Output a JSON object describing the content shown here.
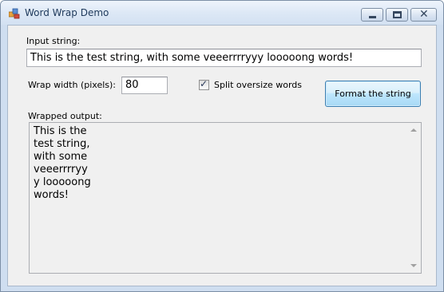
{
  "window": {
    "title": "Word Wrap Demo",
    "controls": {
      "minimize": "minimize-icon",
      "maximize": "maximize-icon",
      "close": "close-icon"
    }
  },
  "form": {
    "input_label": "Input string:",
    "input_value": "This is the test string, with some veeerrrryyy looooong words!",
    "wrap_width_label": "Wrap width (pixels):",
    "wrap_width_value": "80",
    "split_checkbox_label": "Split oversize words",
    "split_checkbox_checked": true,
    "format_button_label": "Format the string",
    "output_label": "Wrapped output:",
    "output_lines": [
      "This is the",
      "test string,",
      "with some",
      "veeerrrryy",
      "y looooong",
      "words!"
    ]
  },
  "colors": {
    "titlebar": "#dbe7f5",
    "client_background": "#f0f0f0",
    "button_accent": "#3c7fb1"
  }
}
